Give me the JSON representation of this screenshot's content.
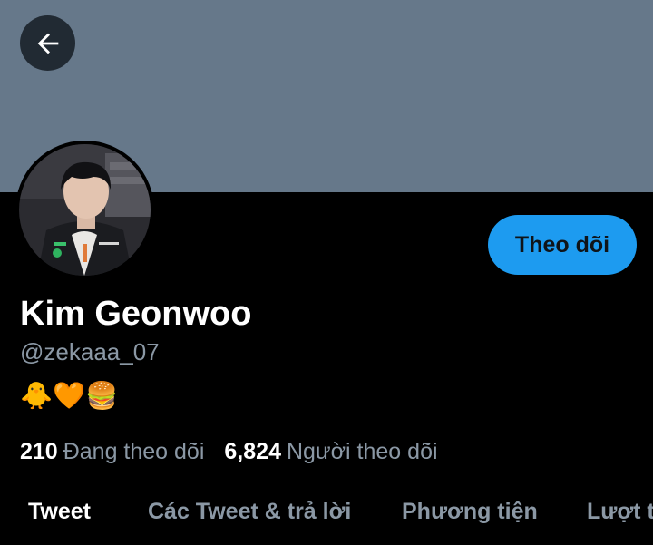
{
  "header": {
    "back_icon": "arrow-left-icon",
    "banner_color": "#66788a"
  },
  "profile": {
    "avatar_alt": "profile photo",
    "follow_label": "Theo dõi",
    "name": "Kim Geonwoo",
    "handle": "@zekaaa_07",
    "bio": "🐥🧡🍔",
    "following_count": "210",
    "following_label": "Đang theo dõi",
    "followers_count": "6,824",
    "followers_label": "Người theo dõi"
  },
  "tabs": [
    {
      "label": "Tweet",
      "active": true
    },
    {
      "label": "Các Tweet & trả lời",
      "active": false
    },
    {
      "label": "Phương tiện",
      "active": false
    },
    {
      "label": "Lượt thích",
      "active": false
    }
  ],
  "colors": {
    "accent": "#1d9bf0",
    "muted_text": "#8b98a5",
    "background": "#000000"
  }
}
